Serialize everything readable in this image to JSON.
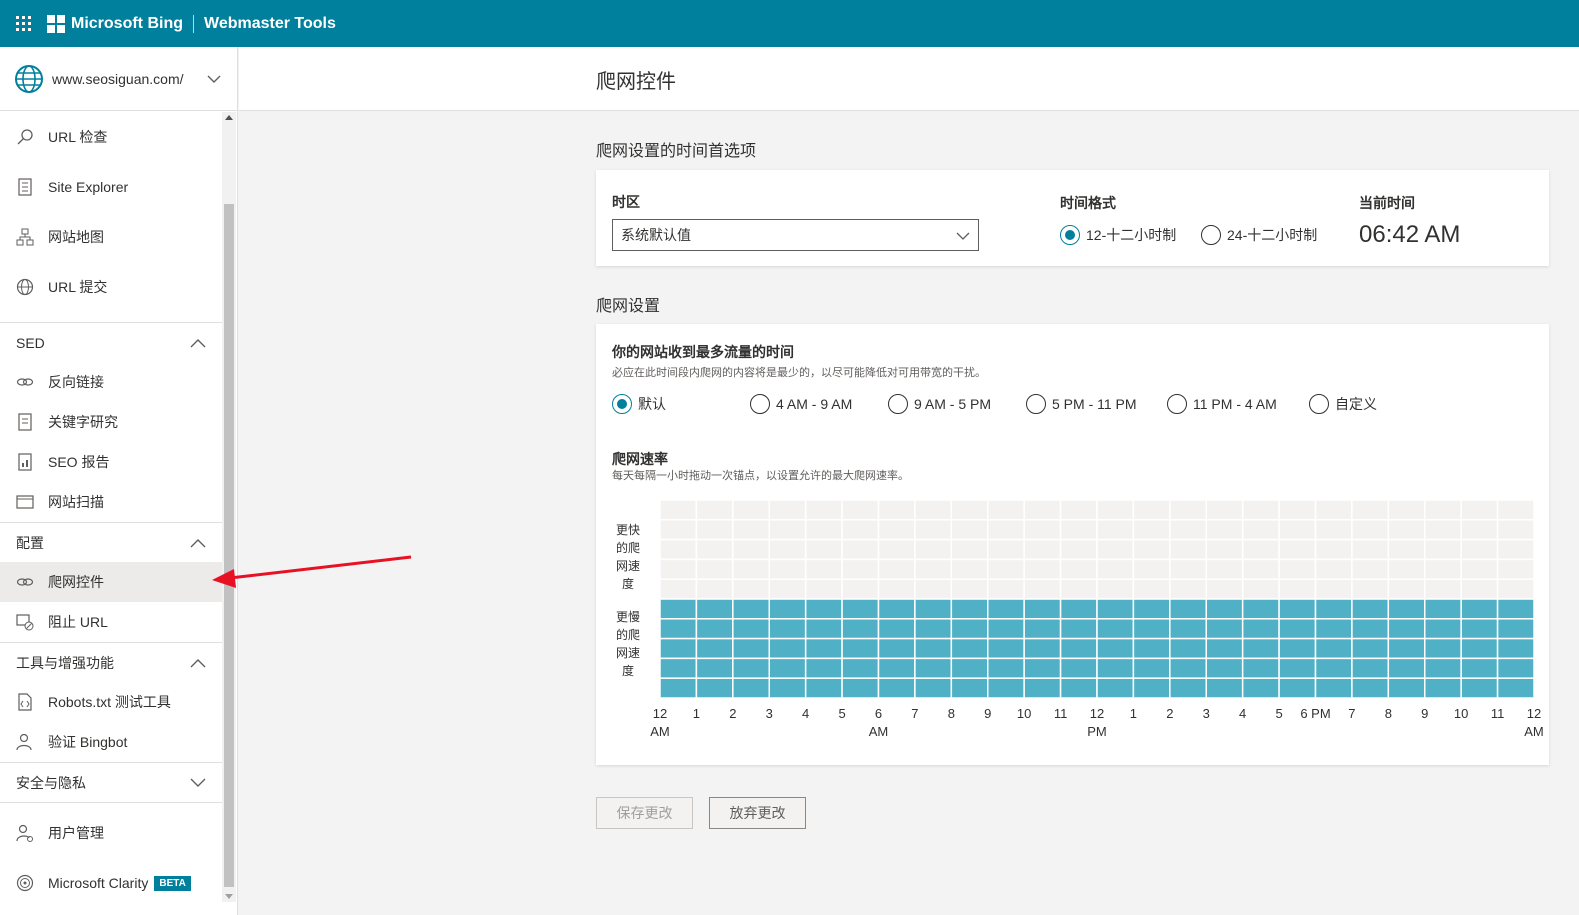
{
  "topbar": {
    "brand": "Microsoft Bing",
    "product": "Webmaster Tools"
  },
  "site": {
    "url": "www.seosiguan.com/"
  },
  "nav": {
    "top_items": [
      {
        "label": "URL 检查",
        "icon": "magnifier-icon"
      },
      {
        "label": "Site Explorer",
        "icon": "document-list-icon"
      },
      {
        "label": "网站地图",
        "icon": "sitemap-icon"
      },
      {
        "label": "URL 提交",
        "icon": "globe-icon"
      }
    ],
    "groups": [
      {
        "label": "SED",
        "expanded": true,
        "items": [
          {
            "label": "反向链接",
            "icon": "link-icon"
          },
          {
            "label": "关键字研究",
            "icon": "document-icon"
          },
          {
            "label": "SEO 报告",
            "icon": "report-icon"
          },
          {
            "label": "网站扫描",
            "icon": "scan-icon"
          }
        ]
      },
      {
        "label": "配置",
        "expanded": true,
        "items": [
          {
            "label": "爬网控件",
            "icon": "link-icon",
            "active": true
          },
          {
            "label": "阻止 URL",
            "icon": "block-url-icon"
          }
        ]
      },
      {
        "label": "工具与增强功能",
        "expanded": true,
        "items": [
          {
            "label": "Robots.txt 测试工具",
            "icon": "file-code-icon"
          },
          {
            "label": "验证 Bingbot",
            "icon": "person-check-icon"
          }
        ]
      },
      {
        "label": "安全与隐私",
        "expanded": false,
        "items": []
      }
    ],
    "bottom_items": [
      {
        "label": "用户管理",
        "icon": "user-settings-icon"
      },
      {
        "label": "Microsoft Clarity",
        "icon": "clarity-icon",
        "badge": "BETA"
      }
    ]
  },
  "page": {
    "title": "爬网控件"
  },
  "time_prefs": {
    "section_title": "爬网设置的时间首选项",
    "timezone_label": "时区",
    "timezone_value": "系统默认值",
    "format_label": "时间格式",
    "format_options": [
      "12-十二小时制",
      "24-十二小时制"
    ],
    "format_selected": 0,
    "current_label": "当前时间",
    "current_time": "06:42 AM"
  },
  "crawl": {
    "section_title": "爬网设置",
    "peak_title": "你的网站收到最多流量的时间",
    "peak_desc": "必应在此时间段内爬网的内容将是最少的，以尽可能降低对可用带宽的干扰。",
    "peak_options": [
      "默认",
      "4 AM - 9 AM",
      "9 AM - 5 PM",
      "5 PM - 11 PM",
      "11 PM - 4 AM",
      "自定义"
    ],
    "peak_selected": 0,
    "rate_title": "爬网速率",
    "rate_desc": "每天每隔一小时拖动一次锚点，以设置允许的最大爬网速率。",
    "y_faster": [
      "更快",
      "的爬",
      "网速",
      "度"
    ],
    "y_slower": [
      "更慢",
      "的爬",
      "网速",
      "度"
    ],
    "x_labels": [
      [
        "12",
        "AM"
      ],
      [
        "1"
      ],
      [
        "2"
      ],
      [
        "3"
      ],
      [
        "4"
      ],
      [
        "5"
      ],
      [
        "6",
        "AM"
      ],
      [
        "7"
      ],
      [
        "8"
      ],
      [
        "9"
      ],
      [
        "10"
      ],
      [
        "11"
      ],
      [
        "12",
        "PM"
      ],
      [
        "1"
      ],
      [
        "2"
      ],
      [
        "3"
      ],
      [
        "4"
      ],
      [
        "5"
      ],
      [
        "6 PM"
      ],
      [
        "7"
      ],
      [
        "8"
      ],
      [
        "9"
      ],
      [
        "10"
      ],
      [
        "11"
      ],
      [
        "12",
        "AM"
      ]
    ],
    "hours": 24,
    "levels_total": 10,
    "levels_per_hour": [
      5,
      5,
      5,
      5,
      5,
      5,
      5,
      5,
      5,
      5,
      5,
      5,
      5,
      5,
      5,
      5,
      5,
      5,
      5,
      5,
      5,
      5,
      5,
      5
    ],
    "fill_color": "#4fb0c6",
    "empty_color": "#f3f2f1"
  },
  "actions": {
    "save": "保存更改",
    "discard": "放弃更改"
  },
  "colors": {
    "brand": "#00809d",
    "annotation_arrow": "#e81123"
  }
}
